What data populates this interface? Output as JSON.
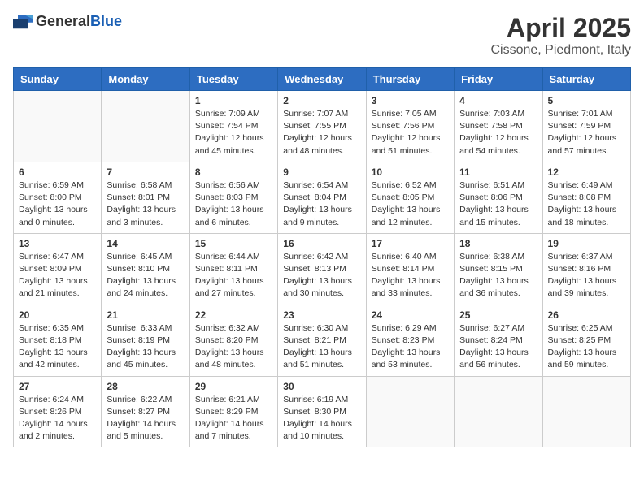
{
  "logo": {
    "general": "General",
    "blue": "Blue"
  },
  "title": "April 2025",
  "location": "Cissone, Piedmont, Italy",
  "weekdays": [
    "Sunday",
    "Monday",
    "Tuesday",
    "Wednesday",
    "Thursday",
    "Friday",
    "Saturday"
  ],
  "weeks": [
    [
      {
        "day": "",
        "info": ""
      },
      {
        "day": "",
        "info": ""
      },
      {
        "day": "1",
        "info": "Sunrise: 7:09 AM\nSunset: 7:54 PM\nDaylight: 12 hours and 45 minutes."
      },
      {
        "day": "2",
        "info": "Sunrise: 7:07 AM\nSunset: 7:55 PM\nDaylight: 12 hours and 48 minutes."
      },
      {
        "day": "3",
        "info": "Sunrise: 7:05 AM\nSunset: 7:56 PM\nDaylight: 12 hours and 51 minutes."
      },
      {
        "day": "4",
        "info": "Sunrise: 7:03 AM\nSunset: 7:58 PM\nDaylight: 12 hours and 54 minutes."
      },
      {
        "day": "5",
        "info": "Sunrise: 7:01 AM\nSunset: 7:59 PM\nDaylight: 12 hours and 57 minutes."
      }
    ],
    [
      {
        "day": "6",
        "info": "Sunrise: 6:59 AM\nSunset: 8:00 PM\nDaylight: 13 hours and 0 minutes."
      },
      {
        "day": "7",
        "info": "Sunrise: 6:58 AM\nSunset: 8:01 PM\nDaylight: 13 hours and 3 minutes."
      },
      {
        "day": "8",
        "info": "Sunrise: 6:56 AM\nSunset: 8:03 PM\nDaylight: 13 hours and 6 minutes."
      },
      {
        "day": "9",
        "info": "Sunrise: 6:54 AM\nSunset: 8:04 PM\nDaylight: 13 hours and 9 minutes."
      },
      {
        "day": "10",
        "info": "Sunrise: 6:52 AM\nSunset: 8:05 PM\nDaylight: 13 hours and 12 minutes."
      },
      {
        "day": "11",
        "info": "Sunrise: 6:51 AM\nSunset: 8:06 PM\nDaylight: 13 hours and 15 minutes."
      },
      {
        "day": "12",
        "info": "Sunrise: 6:49 AM\nSunset: 8:08 PM\nDaylight: 13 hours and 18 minutes."
      }
    ],
    [
      {
        "day": "13",
        "info": "Sunrise: 6:47 AM\nSunset: 8:09 PM\nDaylight: 13 hours and 21 minutes."
      },
      {
        "day": "14",
        "info": "Sunrise: 6:45 AM\nSunset: 8:10 PM\nDaylight: 13 hours and 24 minutes."
      },
      {
        "day": "15",
        "info": "Sunrise: 6:44 AM\nSunset: 8:11 PM\nDaylight: 13 hours and 27 minutes."
      },
      {
        "day": "16",
        "info": "Sunrise: 6:42 AM\nSunset: 8:13 PM\nDaylight: 13 hours and 30 minutes."
      },
      {
        "day": "17",
        "info": "Sunrise: 6:40 AM\nSunset: 8:14 PM\nDaylight: 13 hours and 33 minutes."
      },
      {
        "day": "18",
        "info": "Sunrise: 6:38 AM\nSunset: 8:15 PM\nDaylight: 13 hours and 36 minutes."
      },
      {
        "day": "19",
        "info": "Sunrise: 6:37 AM\nSunset: 8:16 PM\nDaylight: 13 hours and 39 minutes."
      }
    ],
    [
      {
        "day": "20",
        "info": "Sunrise: 6:35 AM\nSunset: 8:18 PM\nDaylight: 13 hours and 42 minutes."
      },
      {
        "day": "21",
        "info": "Sunrise: 6:33 AM\nSunset: 8:19 PM\nDaylight: 13 hours and 45 minutes."
      },
      {
        "day": "22",
        "info": "Sunrise: 6:32 AM\nSunset: 8:20 PM\nDaylight: 13 hours and 48 minutes."
      },
      {
        "day": "23",
        "info": "Sunrise: 6:30 AM\nSunset: 8:21 PM\nDaylight: 13 hours and 51 minutes."
      },
      {
        "day": "24",
        "info": "Sunrise: 6:29 AM\nSunset: 8:23 PM\nDaylight: 13 hours and 53 minutes."
      },
      {
        "day": "25",
        "info": "Sunrise: 6:27 AM\nSunset: 8:24 PM\nDaylight: 13 hours and 56 minutes."
      },
      {
        "day": "26",
        "info": "Sunrise: 6:25 AM\nSunset: 8:25 PM\nDaylight: 13 hours and 59 minutes."
      }
    ],
    [
      {
        "day": "27",
        "info": "Sunrise: 6:24 AM\nSunset: 8:26 PM\nDaylight: 14 hours and 2 minutes."
      },
      {
        "day": "28",
        "info": "Sunrise: 6:22 AM\nSunset: 8:27 PM\nDaylight: 14 hours and 5 minutes."
      },
      {
        "day": "29",
        "info": "Sunrise: 6:21 AM\nSunset: 8:29 PM\nDaylight: 14 hours and 7 minutes."
      },
      {
        "day": "30",
        "info": "Sunrise: 6:19 AM\nSunset: 8:30 PM\nDaylight: 14 hours and 10 minutes."
      },
      {
        "day": "",
        "info": ""
      },
      {
        "day": "",
        "info": ""
      },
      {
        "day": "",
        "info": ""
      }
    ]
  ]
}
